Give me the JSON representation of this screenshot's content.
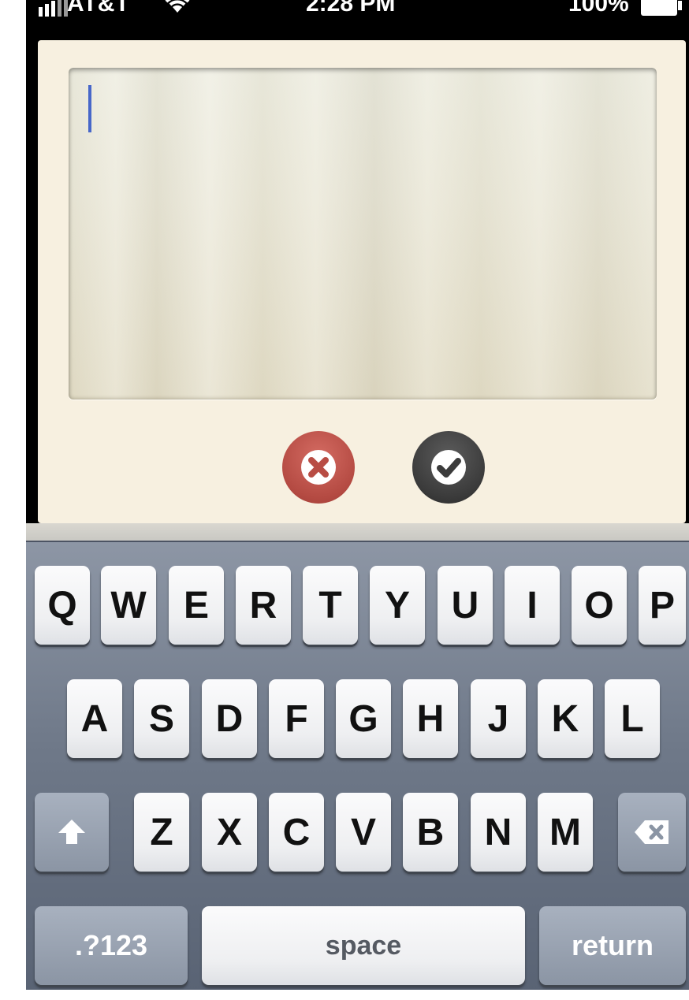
{
  "status_bar": {
    "carrier": "AT&T",
    "time": "2:28 PM",
    "battery": "100%"
  },
  "note_editor": {
    "text": ""
  },
  "actions": {
    "cancel_icon": "close-icon",
    "confirm_icon": "checkmark-icon",
    "cancel_color": "#b84c44",
    "confirm_color": "#3b3b3b"
  },
  "keyboard": {
    "row1": [
      "Q",
      "W",
      "E",
      "R",
      "T",
      "Y",
      "U",
      "I",
      "O",
      "P"
    ],
    "row2": [
      "A",
      "S",
      "D",
      "F",
      "G",
      "H",
      "J",
      "K",
      "L"
    ],
    "row3": [
      "Z",
      "X",
      "C",
      "V",
      "B",
      "N",
      "M"
    ],
    "numbers_label": ".?123",
    "space_label": "space",
    "return_label": "return",
    "shift_icon": "shift-icon",
    "delete_icon": "delete-icon"
  }
}
